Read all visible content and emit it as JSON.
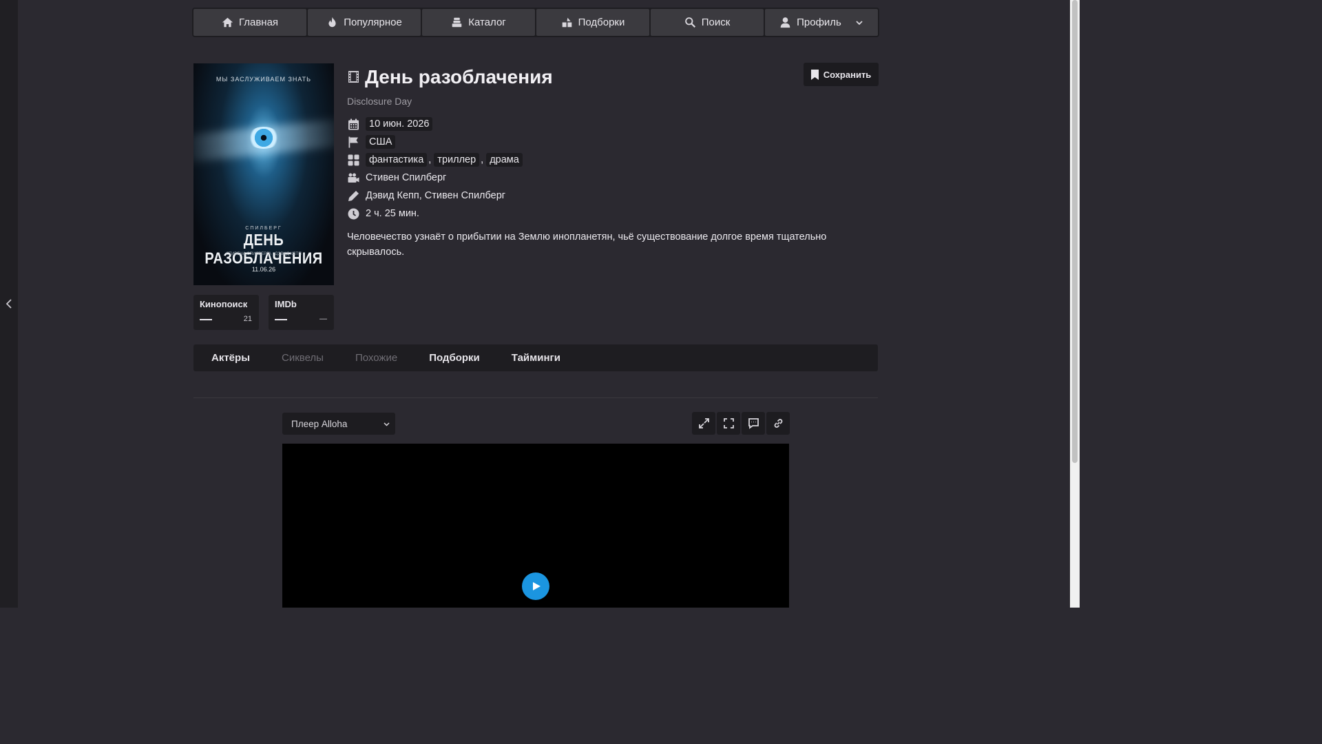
{
  "nav": {
    "items": [
      {
        "label": "Главная",
        "icon": "home-icon"
      },
      {
        "label": "Популярное",
        "icon": "fire-icon"
      },
      {
        "label": "Каталог",
        "icon": "catalog-icon"
      },
      {
        "label": "Подборки",
        "icon": "collections-icon"
      },
      {
        "label": "Поиск",
        "icon": "search-icon"
      },
      {
        "label": "Профиль",
        "icon": "user-icon"
      }
    ]
  },
  "poster": {
    "tagline": "МЫ ЗАСЛУЖИВАЕМ ЗНАТЬ",
    "author": "СПИЛБЕРГ",
    "title": "ДЕНЬ РАЗОБЛАЧЕНИЯ",
    "credits": "СТИВЕНА СПИЛБЕРГА · ДЭВИД КЕПП",
    "date": "11.06.26"
  },
  "ratings": [
    {
      "name": "Кинопоиск",
      "value": "21"
    },
    {
      "name": "IMDb",
      "value": "—"
    }
  ],
  "movie": {
    "title": "День разоблачения",
    "original_title": "Disclosure Day",
    "save_label": "Сохранить",
    "release_date": "10 июн. 2026",
    "country": "США",
    "genres": [
      "фантастика",
      "триллер",
      "драма"
    ],
    "director": "Стивен Спилберг",
    "writers": "Дэвид Кепп, Стивен Спилберг",
    "duration": "2 ч. 25 мин.",
    "description": "Человечество узнаёт о прибытии на Землю инопланетян, чьё существование долгое время тщательно скрывалось."
  },
  "tabs": [
    {
      "label": "Актёры",
      "active": true
    },
    {
      "label": "Сиквелы",
      "active": false
    },
    {
      "label": "Похожие",
      "active": false
    },
    {
      "label": "Подборки",
      "active": true
    },
    {
      "label": "Тайминги",
      "active": true
    }
  ],
  "player": {
    "selected": "Плеер Alloha"
  },
  "colors": {
    "background": "#2b2930",
    "panel": "#1e1d21",
    "accent_play": "#1b95e0"
  }
}
